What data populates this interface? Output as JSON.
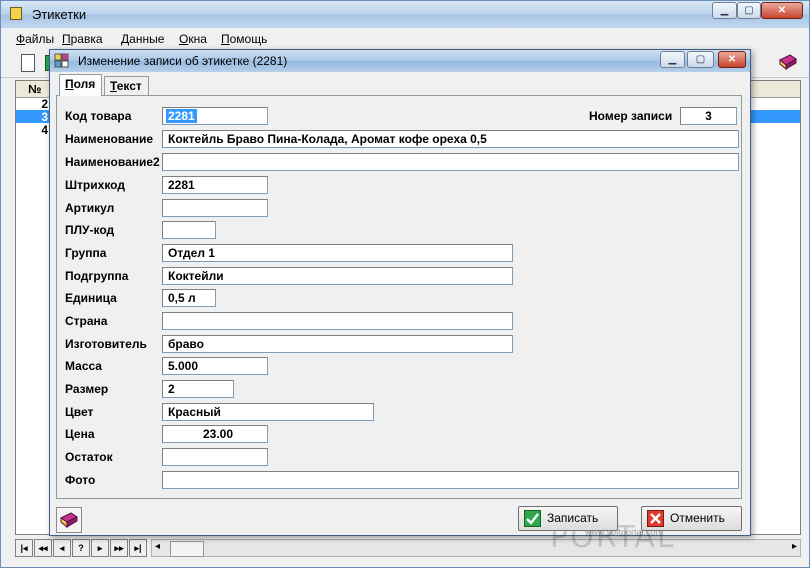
{
  "main": {
    "title": "Этикетки",
    "menu": [
      {
        "label": "Файлы",
        "hot": "Ф",
        "rest": "айлы"
      },
      {
        "label": "Правка",
        "hot": "П",
        "rest": "равка"
      },
      {
        "label": "Данные",
        "hot": "Д",
        "rest": "анные"
      },
      {
        "label": "Окна",
        "hot": "О",
        "rest": "кна"
      },
      {
        "label": "Помощь",
        "hot": "П",
        "rest": "омощь"
      }
    ]
  },
  "grid": {
    "header_num": "№",
    "rows": [
      "2",
      "3",
      "4"
    ],
    "selected_row": "3"
  },
  "nav": [
    "|◂",
    "◂◂",
    "◂",
    "?",
    "▸",
    "▸▸",
    "▸|"
  ],
  "dialog": {
    "title": "Изменение записи об этикетке  (2281)",
    "tabs": [
      {
        "label": "Поля",
        "hot": "П",
        "rest": "оля",
        "active": true
      },
      {
        "label": "Текст",
        "hot": "Т",
        "rest": "екст",
        "active": false
      }
    ],
    "record_label": "Номер записи",
    "record_value": "3",
    "fields": [
      {
        "label": "Код товара",
        "value": "2281"
      },
      {
        "label": "Наименование",
        "value": "Коктейль Браво Пина-Колада, Аромат кофе ореха 0,5"
      },
      {
        "label": "Наименование2",
        "value": ""
      },
      {
        "label": "Штрихкод",
        "value": "2281"
      },
      {
        "label": "Артикул",
        "value": ""
      },
      {
        "label": "ПЛУ-код",
        "value": ""
      },
      {
        "label": "Группа",
        "value": "Отдел 1"
      },
      {
        "label": "Подгруппа",
        "value": "Коктейли"
      },
      {
        "label": "Единица",
        "value": "0,5 л"
      },
      {
        "label": "Страна",
        "value": ""
      },
      {
        "label": "Изготовитель",
        "value": "браво"
      },
      {
        "label": "Масса",
        "value": "5.000"
      },
      {
        "label": "Размер",
        "value": "2"
      },
      {
        "label": "Цвет",
        "value": "Красный"
      },
      {
        "label": "Цена",
        "value": "23.00"
      },
      {
        "label": "Остаток",
        "value": ""
      },
      {
        "label": "Фото",
        "value": ""
      }
    ],
    "save_label": "Записать",
    "cancel_label": "Отменить"
  },
  "watermark": {
    "text": "PORTAL",
    "url": "www.softportal.com"
  },
  "colors": {
    "selection": "#3399ff",
    "title_bar": "#a9c6e6"
  }
}
